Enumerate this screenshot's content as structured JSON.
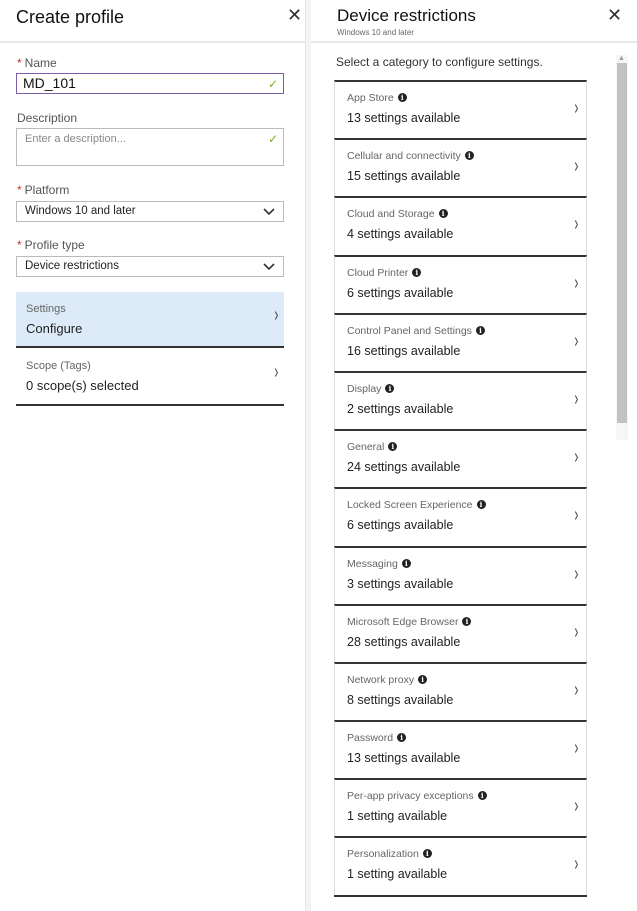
{
  "create_profile": {
    "title": "Create profile",
    "close_glyph": "✕",
    "name": {
      "label": "Name",
      "required_mark": "*",
      "value": "MD_101",
      "valid_icon": "✓"
    },
    "description": {
      "label": "Description",
      "placeholder": "Enter a description...",
      "valid_icon": "✓"
    },
    "platform": {
      "label": "Platform",
      "required_mark": "*",
      "value": "Windows 10 and later",
      "chevron": "⌄"
    },
    "profile_type": {
      "label": "Profile type",
      "required_mark": "*",
      "value": "Device restrictions",
      "chevron": "⌄"
    },
    "settings": {
      "label": "Settings",
      "value": "Configure",
      "chevron": "›",
      "selected_bg": "#dcebf7"
    },
    "scope": {
      "label": "Scope (Tags)",
      "value": "0 scope(s) selected",
      "chevron": "›"
    }
  },
  "device_restrictions": {
    "title": "Device restrictions",
    "subtitle": "Windows 10 and later",
    "close_glyph": "✕",
    "intro": "Select a category to configure settings.",
    "info_glyph": "i",
    "chevron": "›",
    "categories": [
      {
        "name": "App Store",
        "count": "13 settings available"
      },
      {
        "name": "Cellular and connectivity",
        "count": "15 settings available"
      },
      {
        "name": "Cloud and Storage",
        "count": "4 settings available"
      },
      {
        "name": "Cloud Printer",
        "count": "6 settings available"
      },
      {
        "name": "Control Panel and Settings",
        "count": "16 settings available"
      },
      {
        "name": "Display",
        "count": "2 settings available"
      },
      {
        "name": "General",
        "count": "24 settings available"
      },
      {
        "name": "Locked Screen Experience",
        "count": "6 settings available"
      },
      {
        "name": "Messaging",
        "count": "3 settings available"
      },
      {
        "name": "Microsoft Edge Browser",
        "count": "28 settings available"
      },
      {
        "name": "Network proxy",
        "count": "8 settings available"
      },
      {
        "name": "Password",
        "count": "13 settings available"
      },
      {
        "name": "Per-app privacy exceptions",
        "count": "1 setting available"
      },
      {
        "name": "Personalization",
        "count": "1 setting available"
      }
    ],
    "scrollbar": {
      "up_glyph": "▲"
    }
  }
}
